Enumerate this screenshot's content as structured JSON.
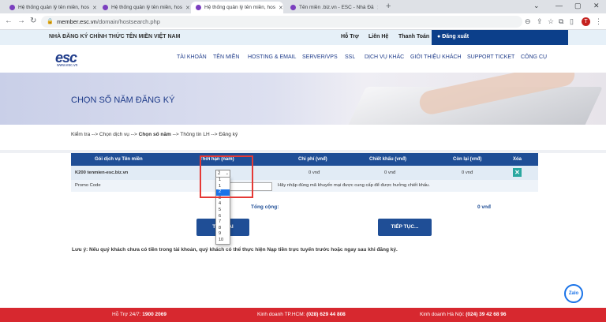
{
  "browser": {
    "tabs": [
      {
        "title": "Hệ thống quản lý tên miền, hos",
        "active": false,
        "favicon_color": "#7b3fbf"
      },
      {
        "title": "Hệ thống quản lý tên miền, hos",
        "active": false,
        "favicon_color": "#7b3fbf"
      },
      {
        "title": "Hệ thống quản lý tên miền, hos",
        "active": true,
        "favicon_color": "#7b3fbf"
      },
      {
        "title": "Tên miền .biz.vn - ESC - Nhà Đă",
        "active": false,
        "favicon_color": "#7b3fbf"
      }
    ],
    "new_tab": "+",
    "url_domain": "member.esc.vn",
    "url_path": "/domain/hostsearch.php",
    "avatar_letter": "T"
  },
  "topbar": {
    "tagline": "NHÀ ĐĂNG KÝ CHÍNH THỨC TÊN MIỀN VIỆT NAM",
    "links": [
      "Hỗ Trợ",
      "Liên Hệ",
      "Thanh Toán"
    ],
    "logout": "Đăng xuất"
  },
  "logo": {
    "text": "esc",
    "url": "www.esc.vn"
  },
  "menu": [
    "TÀI KHOẢN",
    "TÊN MIỀN",
    "HOSTING & EMAIL",
    "SERVER/VPS",
    "SSL",
    "DỊCH VỤ KHÁC",
    "GIỚI THIỆU KHÁCH",
    "SUPPORT TICKET",
    "CÔNG CỤ"
  ],
  "banner": {
    "title": "CHỌN SỐ NĂM ĐĂNG KÝ"
  },
  "breadcrumb": {
    "part1": "Kiểm tra --> Chọn dịch vụ --> ",
    "current": "Chọn số năm",
    "part2": " --> Thông tin LH --> Đăng ký"
  },
  "table": {
    "headers": [
      "Gói dịch vụ Tên miền",
      "Thời hạn (năm)",
      "Chi phí (vnđ)",
      "Chiết khấu (vnđ)",
      "Còn lại (vnđ)",
      "Xóa"
    ],
    "row": {
      "name": "K200 tenmien-esc.biz.vn",
      "years": "2",
      "cost": "0 vnđ",
      "discount": "0 vnđ",
      "remaining": "0 vnđ"
    },
    "promo_label": "Promo Code",
    "promo_hint": "Hãy nhập đúng mã khuyến mại được cung cấp để được hưởng chiết khấu.",
    "total_label": "Tổng cộng:",
    "total_value": "0 vnđ"
  },
  "dropdown_options": [
    "1",
    "1",
    "2",
    "3",
    "4",
    "5",
    "6",
    "7",
    "8",
    "9",
    "10"
  ],
  "buttons": {
    "back": "TRỞ LẠI",
    "next": "TIẾP TỤC..."
  },
  "note": "Lưu ý: Nếu quý khách chưa có tiền trong tài khoản, quý khách có thể thực hiện Nạp tiền trực tuyến trước hoặc ngay sau khi đăng ký.",
  "zalo": "Zalo",
  "footer": {
    "support_label": "Hỗ Trợ 24/7:",
    "support_phone": "1900 2069",
    "hcm_label": "Kinh doanh TP.HCM:",
    "hcm_phone": "(028) 629 44 808",
    "hn_label": "Kinh doanh Hà Nội:",
    "hn_phone": "(024) 39 42 68 96"
  }
}
